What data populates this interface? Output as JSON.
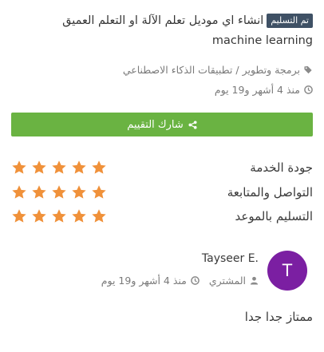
{
  "order": {
    "status_badge": "تم التسليم",
    "title": "انشاء اي موديل تعلم الآلة او التعلم العميق machine learning",
    "category_parent": "برمجة وتطوير",
    "category_separator": "/",
    "category_child": "تطبيقات الذكاء الاصطناعي",
    "time_ago": "منذ 4 أشهر و19 يوم"
  },
  "share_button": {
    "label": "شارك التقييم",
    "icon": "share-icon"
  },
  "ratings": [
    {
      "label": "جودة الخدمة",
      "stars": 5,
      "max": 5
    },
    {
      "label": "التواصل والمتابعة",
      "stars": 5,
      "max": 5
    },
    {
      "label": "التسليم بالموعد",
      "stars": 5,
      "max": 5
    }
  ],
  "review": {
    "avatar_letter": "T",
    "reviewer_name": "Tayseer E.",
    "reviewer_role": "المشتري",
    "time_ago": "منذ 4 أشهر و19 يوم",
    "comment": "ممتاز جدا جدا"
  },
  "colors": {
    "badge_bg": "#3f5165",
    "share_button_bg": "#6ab342",
    "star": "#f0913a",
    "avatar_bg": "#7b1fa2"
  }
}
